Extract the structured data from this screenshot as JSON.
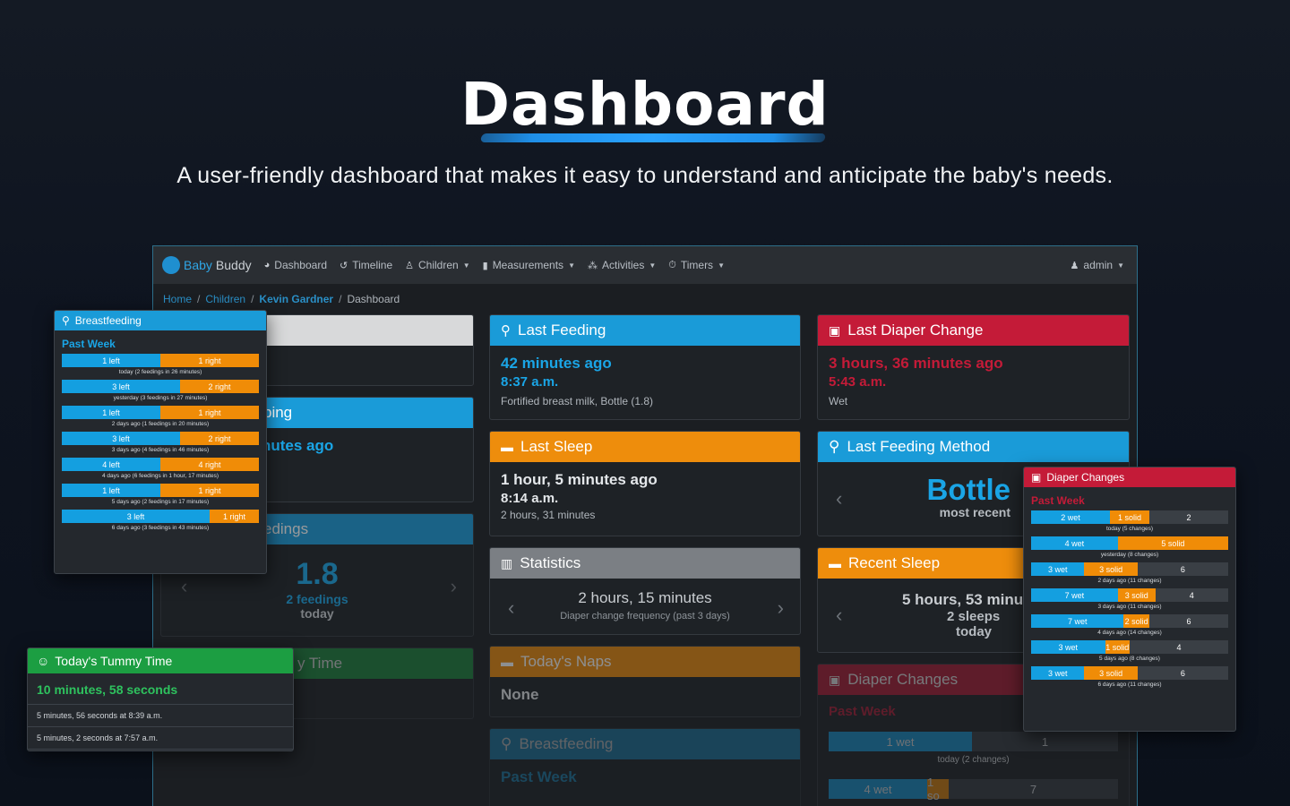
{
  "hero": {
    "title": "Dashboard",
    "subtitle": "A user-friendly dashboard that makes it easy to understand and anticipate the baby's needs."
  },
  "navbar": {
    "brand_part1": "Baby",
    "brand_part2": "Buddy",
    "items": [
      {
        "label": "Dashboard",
        "icon": "dashboard-icon"
      },
      {
        "label": "Timeline",
        "icon": "history-icon"
      },
      {
        "label": "Children",
        "icon": "child-icon"
      },
      {
        "label": "Measurements",
        "icon": "clipboard-icon"
      },
      {
        "label": "Activities",
        "icon": "activities-icon"
      },
      {
        "label": "Timers",
        "icon": "timer-icon"
      }
    ],
    "user": "admin"
  },
  "breadcrumb": [
    "Home",
    "Children",
    "Kevin Gardner",
    "Dashboard"
  ],
  "cards": {
    "last_feeding": {
      "title": "Last Feeding",
      "ago": "42 minutes ago",
      "time": "8:37 a.m.",
      "detail": "Fortified breast milk, Bottle (1.8)"
    },
    "last_diaper": {
      "title": "Last Diaper Change",
      "ago": "3 hours, 36 minutes ago",
      "time": "5:43 a.m.",
      "detail": "Wet"
    },
    "last_sleep": {
      "title": "Last Sleep",
      "ago": "1 hour, 5 minutes ago",
      "time": "8:14 a.m.",
      "detail": "2 hours, 31 minutes"
    },
    "last_feeding_method": {
      "title": "Last Feeding Method",
      "value": "Bottle",
      "sub": "most recent"
    },
    "statistics": {
      "title": "Statistics",
      "value": "2 hours, 15 minutes",
      "sub": "Diaper change frequency (past 3 days)"
    },
    "recent_sleep": {
      "title": "Recent Sleep",
      "value": "5 hours, 53 minu",
      "sub1": "2 sleeps",
      "sub2": "today"
    },
    "todays_naps": {
      "title": "Today's Naps",
      "value": "None"
    },
    "diaper_changes_bg": {
      "title": "Diaper Changes",
      "sub": "Past Week",
      "row1_wet": "1 wet",
      "row1_total": "1",
      "row1_caption": "today (2 changes)",
      "row2_wet": "4 wet",
      "row2_solid": "1 so",
      "row2_total": "7"
    },
    "breastfeeding_bg": {
      "title": "Breastfeeding",
      "sub": "Past Week"
    },
    "sleeping_partial": {
      "title": "ping",
      "value": "nutes ago"
    },
    "feedings_partial": {
      "title": "edings",
      "value": "1.8",
      "sub1": "2 feedings",
      "sub2": "today"
    },
    "tummy_partial": {
      "title": "y Time"
    }
  },
  "breastfeeding_popup": {
    "title": "Breastfeeding",
    "sub": "Past Week",
    "rows": [
      {
        "left": "1 left",
        "right": "1 right",
        "left_frac": 0.5,
        "caption": "today (2 feedings in 26 minutes)"
      },
      {
        "left": "3 left",
        "right": "2 right",
        "left_frac": 0.6,
        "caption": "yesterday (3 feedings in 27 minutes)"
      },
      {
        "left": "1 left",
        "right": "1 right",
        "left_frac": 0.5,
        "caption": "2 days ago (1 feedings in 20 minutes)"
      },
      {
        "left": "3 left",
        "right": "2 right",
        "left_frac": 0.6,
        "caption": "3 days ago (4 feedings in 46 minutes)"
      },
      {
        "left": "4 left",
        "right": "4 right",
        "left_frac": 0.5,
        "caption": "4 days ago (6 feedings in 1 hour, 17 minutes)"
      },
      {
        "left": "1 left",
        "right": "1 right",
        "left_frac": 0.5,
        "caption": "5 days ago (2 feedings in 17 minutes)"
      },
      {
        "left": "3 left",
        "right": "1 right",
        "left_frac": 0.75,
        "caption": "6 days ago (3 feedings in 43 minutes)"
      }
    ]
  },
  "diaper_popup": {
    "title": "Diaper Changes",
    "sub": "Past Week",
    "rows": [
      {
        "wet": "2 wet",
        "solid": "1 solid",
        "total": "2",
        "wet_frac": 0.4,
        "solid_frac": 0.2,
        "caption": "today (5 changes)"
      },
      {
        "wet": "4 wet",
        "solid": "5 solid",
        "total": "",
        "wet_frac": 0.44,
        "solid_frac": 0.56,
        "caption": "yesterday (8 changes)"
      },
      {
        "wet": "3 wet",
        "solid": "3 solid",
        "total": "6",
        "wet_frac": 0.27,
        "solid_frac": 0.27,
        "caption": "2 days ago (11 changes)"
      },
      {
        "wet": "7 wet",
        "solid": "3 solid",
        "total": "4",
        "wet_frac": 0.44,
        "solid_frac": 0.19,
        "caption": "3 days ago (11 changes)"
      },
      {
        "wet": "7 wet",
        "solid": "2 solid",
        "total": "6",
        "wet_frac": 0.47,
        "solid_frac": 0.13,
        "caption": "4 days ago (14 changes)"
      },
      {
        "wet": "3 wet",
        "solid": "1 solid",
        "total": "4",
        "wet_frac": 0.375,
        "solid_frac": 0.125,
        "caption": "5 days ago (8 changes)"
      },
      {
        "wet": "3 wet",
        "solid": "3 solid",
        "total": "6",
        "wet_frac": 0.27,
        "solid_frac": 0.27,
        "caption": "6 days ago (11 changes)"
      }
    ]
  },
  "tummy_popup": {
    "title": "Today's Tummy Time",
    "total": "10 minutes, 58 seconds",
    "entries": [
      "5 minutes, 56 seconds at 8:39 a.m.",
      "5 minutes, 2 seconds at 7:57 a.m."
    ]
  },
  "colors": {
    "blue": "#1a9bd8",
    "red": "#c41b38",
    "orange": "#ee8d0c",
    "green": "#1c9e42",
    "gray": "#7b7f84"
  }
}
